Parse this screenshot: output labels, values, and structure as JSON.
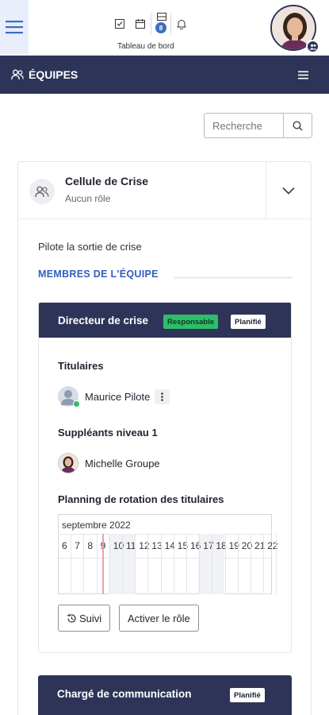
{
  "topbar": {
    "caption": "Tableau de bord",
    "mail_badge": "8"
  },
  "section": {
    "title": "ÉQUIPES"
  },
  "search": {
    "placeholder": "Recherche"
  },
  "team": {
    "name": "Cellule de Crise",
    "role": "Aucun rôle",
    "description": "Pilote la sortie de crise",
    "members_title": "MEMBRES DE L'ÉQUIPE"
  },
  "role_card": {
    "title": "Directeur de crise",
    "tag_responsable": "Responsable",
    "tag_status": "Planifié",
    "titulaires_label": "Titulaires",
    "titulaire_name": "Maurice Pilote",
    "suppleants_label": "Suppléants niveau 1",
    "suppleant_name": "Michelle Groupe",
    "planning_label": "Planning de rotation des titulaires",
    "calendar_month": "septembre 2022",
    "calendar_days": [
      "6",
      "7",
      "8",
      "9",
      "10",
      "11",
      "12",
      "13",
      "14",
      "15",
      "16",
      "17",
      "18",
      "19",
      "20",
      "21",
      "22"
    ],
    "suivi_label": "Suivi",
    "activer_label": "Activer le rôle"
  },
  "role_card_2": {
    "title": "Chargé de communication",
    "tag_status": "Planifié"
  },
  "colors": {
    "navy": "#2e3458",
    "accent_blue": "#2f5fbf",
    "green": "#2ebd6b"
  }
}
